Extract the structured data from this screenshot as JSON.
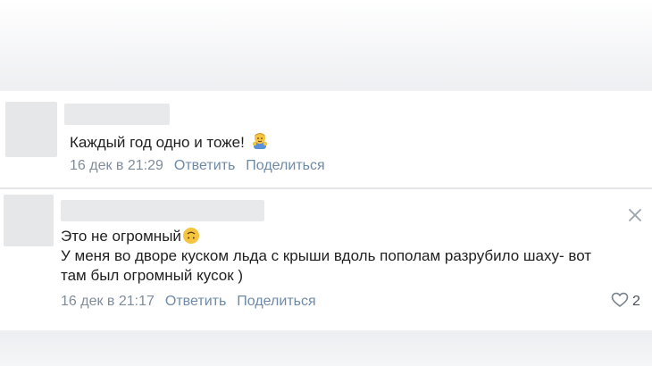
{
  "comments": [
    {
      "text": "Каждый год одно и тоже!",
      "emoji": "person-gesturing-emoji",
      "time": "16 дек в 21:29",
      "reply_label": "Ответить",
      "share_label": "Поделиться"
    },
    {
      "text_line1": "Это не огромный",
      "emoji": "upside-down-face-emoji",
      "text_line2": "У меня во дворе куском льда с крыши вдоль пополам разрубило шаху- вот",
      "text_line3": "там был огромный кусок )",
      "time": "16 дек в 21:17",
      "reply_label": "Ответить",
      "share_label": "Поделиться",
      "likes": "2",
      "close_icon": "close-icon",
      "like_icon": "heart-icon"
    }
  ],
  "colors": {
    "text": "#1f1f1f",
    "meta_time": "#818c99",
    "meta_link": "#6f8aa8",
    "emoji_yellow": "#f5c542",
    "emoji_blue": "#5b8fd6"
  }
}
